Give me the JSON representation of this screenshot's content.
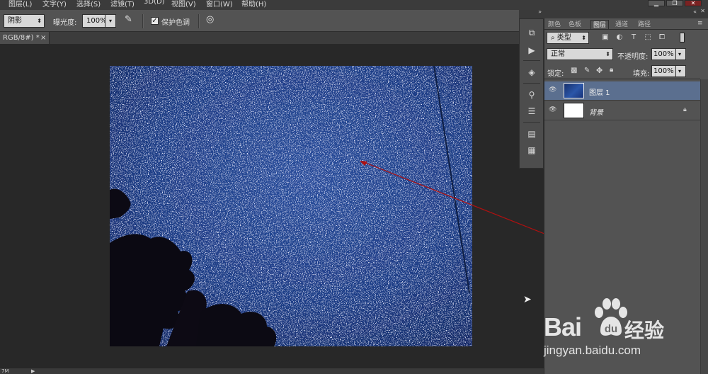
{
  "menu": {
    "items": [
      "图层(L)",
      "文字(Y)",
      "选择(S)",
      "滤镜(T)",
      "3D(D)",
      "视图(V)",
      "窗口(W)",
      "帮助(H)"
    ]
  },
  "window_controls": {
    "minimize": "▁",
    "restore": "❐",
    "close": "✕"
  },
  "options": {
    "range_value": "阴影",
    "exposure_label": "曝光度:",
    "exposure_value": "100%",
    "protect_tone_label": "保护色调",
    "protect_tone_checked": true
  },
  "document": {
    "tab_label": "RGB/8#) *",
    "close_glyph": "×",
    "status_text": "7M"
  },
  "layers_panel": {
    "tabs": [
      "颜色",
      "色板",
      "图层",
      "通道",
      "路径"
    ],
    "active_tab": "图层",
    "filter_kind": "类型",
    "blend_mode": "正常",
    "opacity_label": "不透明度:",
    "opacity_value": "100%",
    "lock_label": "锁定:",
    "fill_label": "填充:",
    "fill_value": "100%",
    "layers": [
      {
        "name": "图层 1",
        "selected": true,
        "visible": true
      },
      {
        "name": "背景",
        "selected": false,
        "visible": true,
        "locked": true
      }
    ]
  },
  "watermark": {
    "brand": "Bai",
    "brand_tail": "经验",
    "url": "jingyan.baidu.com"
  },
  "colors": {
    "accent_arrow": "#b01010",
    "selected_layer": "#5b6f8f",
    "sky": "#1f3f8a"
  }
}
